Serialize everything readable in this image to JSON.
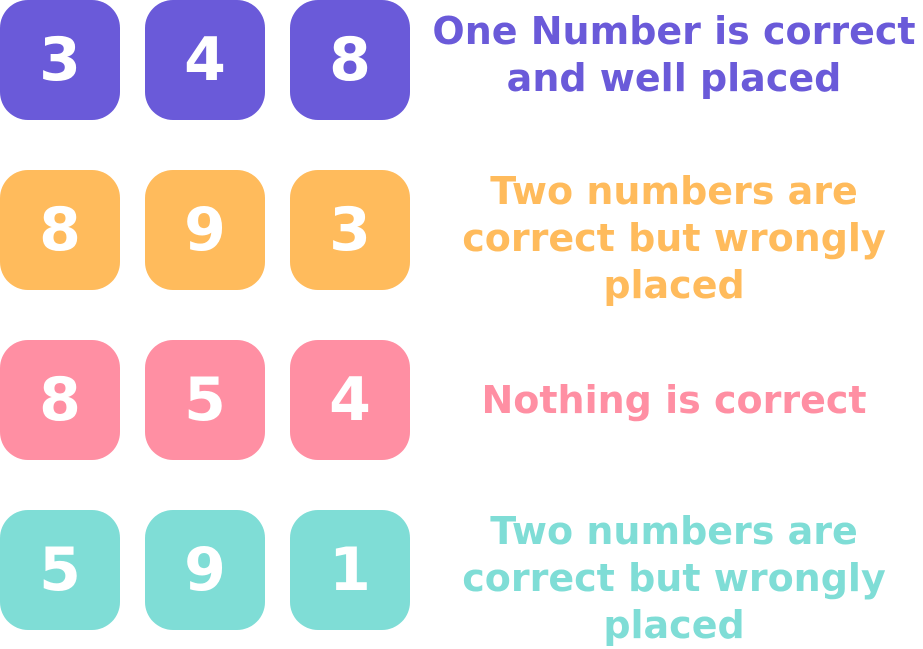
{
  "rows": [
    {
      "digits": [
        "3",
        "4",
        "8"
      ],
      "clue": "One Number is correct and well placed",
      "color": "#6a5ad9"
    },
    {
      "digits": [
        "8",
        "9",
        "3"
      ],
      "clue": "Two numbers are correct but wrongly placed",
      "color": "#ffbb5c"
    },
    {
      "digits": [
        "8",
        "5",
        "4"
      ],
      "clue": "Nothing is correct",
      "color": "#ff8fa3"
    },
    {
      "digits": [
        "5",
        "9",
        "1"
      ],
      "clue": "Two numbers are correct but wrongly placed",
      "color": "#7fddd6"
    }
  ]
}
